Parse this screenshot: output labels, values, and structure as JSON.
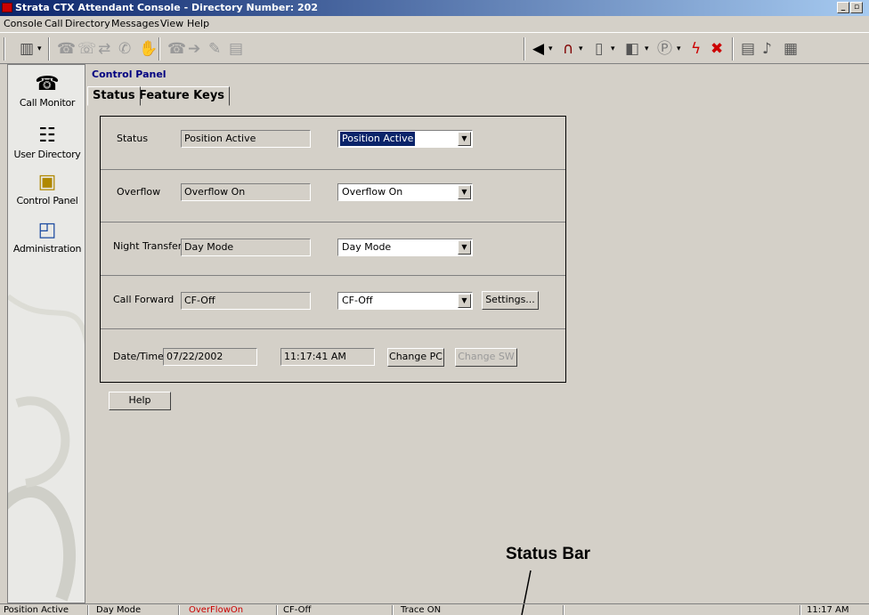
{
  "window": {
    "title": "Strata CTX Attendant Console - Directory Number: 202",
    "minimize_glyph": "_",
    "restore_glyph": "▫"
  },
  "menu": [
    "Console",
    "Call",
    "Directory",
    "Messages",
    "View",
    "Help"
  ],
  "toolbar": {
    "dropdown_glyph": "▾",
    "call_buttons": [
      "toolbar-dial-icon",
      "toolbar-answer-icon",
      "toolbar-release-icon",
      "toolbar-transfer-icon",
      "toolbar-conference-icon",
      "toolbar-hold-icon",
      "toolbar-forward-icon",
      "toolbar-park-icon",
      "toolbar-pickup-icon",
      "toolbar-record-icon"
    ],
    "right_buttons": [
      "volume-icon",
      "headset-icon",
      "door-icon",
      "door-open-icon",
      "park-icon",
      "flash-icon",
      "cancel-icon",
      "notes-icon",
      "paging-icon",
      "calculator-icon"
    ]
  },
  "nav": [
    {
      "label": "Call Monitor",
      "icon": "call-monitor-icon"
    },
    {
      "label": "User Directory",
      "icon": "user-directory-icon"
    },
    {
      "label": "Control Panel",
      "icon": "control-panel-icon"
    },
    {
      "label": "Administration",
      "icon": "administration-icon"
    }
  ],
  "control_panel_title": "Control Panel",
  "tabs": [
    "Status",
    "Feature Keys"
  ],
  "rows": {
    "status": {
      "label": "Status",
      "current": "Position Active",
      "selected": "Position Active"
    },
    "overflow": {
      "label": "Overflow",
      "current": "Overflow On",
      "selected": "Overflow On"
    },
    "night_transfer": {
      "label": "Night Transfer",
      "current": "Day Mode",
      "selected": "Day Mode"
    },
    "call_forward": {
      "label": "Call Forward",
      "current": "CF-Off",
      "selected": "CF-Off",
      "settings_button": "Settings..."
    },
    "datetime": {
      "label": "Date/Time",
      "date": "07/22/2002",
      "time": "11:17:41 AM",
      "change_pc": "Change PC",
      "change_sw": "Change SW"
    }
  },
  "help_button": "Help",
  "annotation": "Status Bar",
  "statusbar": {
    "position": "Position Active",
    "mode": "Day Mode",
    "overflow": "OverFlowOn",
    "call_forward": "CF-Off",
    "trace": "Trace ON",
    "clock": "11:17 AM"
  },
  "colors": {
    "titlebar_start": "#0a246a",
    "titlebar_end": "#a6caf0",
    "selection": "#0a246a",
    "panel_title": "#000080",
    "overflow_status": "#cc0000"
  }
}
